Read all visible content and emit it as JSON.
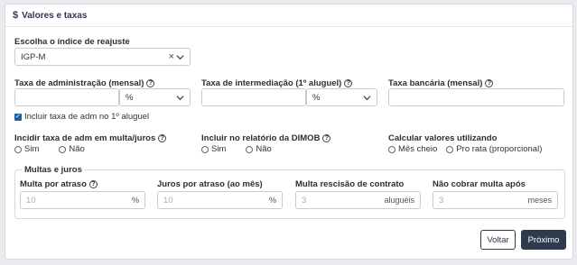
{
  "header": {
    "icon": "dollar-icon",
    "title": "Valores e taxas"
  },
  "reajuste": {
    "label": "Escolha o índice de reajuste",
    "value": "IGP-M",
    "clear_glyph": "×"
  },
  "adm": {
    "label": "Taxa de administração (mensal)",
    "value": "",
    "unit": "%"
  },
  "intermediacao": {
    "label": "Taxa de intermediação (1º aluguel)",
    "value": "",
    "unit": "%"
  },
  "bancaria": {
    "label": "Taxa bancária (mensal)",
    "value": ""
  },
  "incluir_adm": {
    "label": "Incluir taxa de adm no 1º aluguel",
    "checked": true
  },
  "incidir": {
    "label": "Incidir taxa de adm em multa/juros",
    "options": [
      "Sim",
      "Não"
    ]
  },
  "dimob": {
    "label": "Incluir no relatório da DIMOB",
    "options": [
      "Sim",
      "Não"
    ]
  },
  "calcular": {
    "label": "Calcular valores utilizando",
    "options": [
      "Mês cheio",
      "Pro rata (proporcional)"
    ]
  },
  "multas": {
    "legend": "Multas e juros",
    "multa_atraso": {
      "label": "Multa por atraso",
      "placeholder": "10",
      "suffix": "%"
    },
    "juros_atraso": {
      "label": "Juros por atraso (ao mês)",
      "placeholder": "10",
      "suffix": "%"
    },
    "multa_rescisao": {
      "label": "Multa rescisão de contrato",
      "placeholder": "3",
      "suffix": "aluguéis"
    },
    "nao_cobrar": {
      "label": "Não cobrar multa após",
      "placeholder": "3",
      "suffix": "meses"
    }
  },
  "footer": {
    "back_label": "Voltar",
    "next_label": "Próximo"
  },
  "colors": {
    "primary": "#2e3a4e",
    "accent": "#1f5fa8"
  }
}
